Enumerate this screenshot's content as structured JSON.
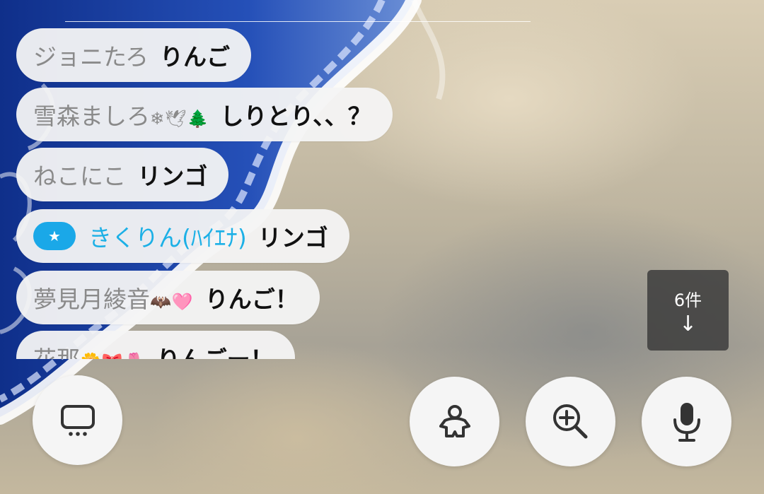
{
  "chat": {
    "messages": [
      {
        "name": "ジョニたろ",
        "emoji": "",
        "text": "りんご"
      },
      {
        "name": "雪森ましろ",
        "emoji": "❄🕊🌲",
        "text": "しりとり、、？"
      },
      {
        "name": "ねこにこ",
        "emoji": "",
        "text": "リンゴ"
      },
      {
        "name": "きくりん(ﾊｲｴﾅ)",
        "emoji": "",
        "text": "リンゴ",
        "badge": "★"
      },
      {
        "name": "夢見月綾音",
        "emoji": "🦇🩷",
        "text": "りんご！"
      },
      {
        "name": "花那",
        "emoji": "🌼🎀🌷",
        "text": "りんごー！"
      }
    ]
  },
  "new_messages": {
    "count_label": "6件",
    "arrow": "↓"
  },
  "controls": {
    "screen_icon": "screen-icon",
    "avatar_icon": "avatar-icon",
    "zoom_icon": "zoom-in-icon",
    "mic_icon": "microphone-icon"
  },
  "colors": {
    "moderator_name": "#1cb0e6",
    "badge": "#1aa8e8",
    "bubble": "#f4f4f4"
  }
}
